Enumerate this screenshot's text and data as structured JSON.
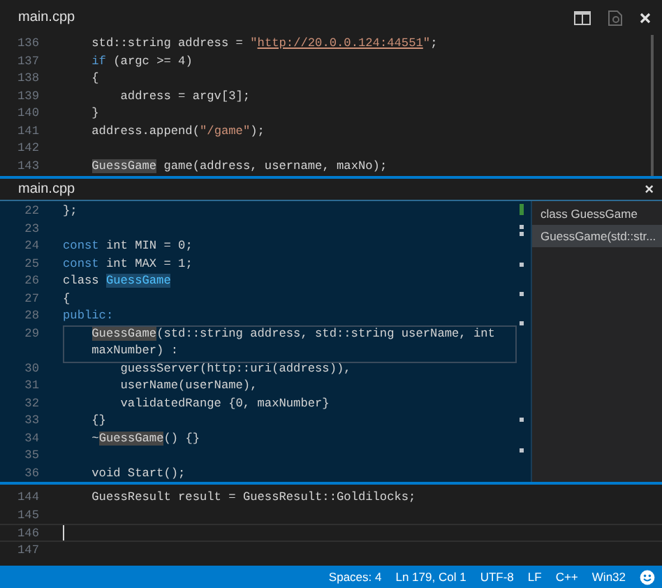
{
  "editor": {
    "tab": {
      "title": "main.cpp"
    },
    "lines": [
      {
        "number": "136",
        "tokens": [
          {
            "text": "    std::string address = ",
            "kind": "plain"
          },
          {
            "text": "\"",
            "kind": "string"
          },
          {
            "text": "http://20.0.0.124:44551",
            "kind": "link"
          },
          {
            "text": "\"",
            "kind": "string"
          },
          {
            "text": ";",
            "kind": "plain"
          }
        ]
      },
      {
        "number": "137",
        "tokens": [
          {
            "text": "    if",
            "kind": "keyword"
          },
          {
            "text": " (argc >= 4)",
            "kind": "plain"
          }
        ]
      },
      {
        "number": "138",
        "tokens": [
          {
            "text": "    {",
            "kind": "plain"
          }
        ]
      },
      {
        "number": "139",
        "tokens": [
          {
            "text": "        address = argv[3];",
            "kind": "plain"
          }
        ]
      },
      {
        "number": "140",
        "tokens": [
          {
            "text": "    }",
            "kind": "plain"
          }
        ]
      },
      {
        "number": "141",
        "tokens": [
          {
            "text": "    address.append(",
            "kind": "plain"
          },
          {
            "text": "\"/game\"",
            "kind": "string"
          },
          {
            "text": ");",
            "kind": "plain"
          }
        ]
      },
      {
        "number": "142"
      },
      {
        "number": "143",
        "tokens": [
          {
            "text": "    GuessGame",
            "kind": "highlight"
          },
          {
            "text": " game(address, username, maxNo);",
            "kind": "plain"
          }
        ]
      }
    ],
    "peek": {
      "title": "main.cpp",
      "close": "×",
      "lines": [
        {
          "number": "22",
          "tokens": [
            {
              "text": "};",
              "kind": "plain"
            }
          ]
        },
        {
          "number": "23"
        },
        {
          "number": "24",
          "tokens": [
            {
              "text": "const",
              "kind": "keyword"
            },
            {
              "text": " int MIN = 0;",
              "kind": "plain"
            }
          ]
        },
        {
          "number": "25",
          "tokens": [
            {
              "text": "const",
              "kind": "keyword"
            },
            {
              "text": " int MAX = 1;",
              "kind": "plain"
            }
          ]
        },
        {
          "number": "26",
          "tokens": [
            {
              "text": "class ",
              "kind": "plain"
            },
            {
              "text": "GuessGame",
              "kind": "definition"
            }
          ]
        },
        {
          "number": "27",
          "tokens": [
            {
              "text": "{",
              "kind": "plain"
            }
          ]
        },
        {
          "number": "28",
          "tokens": [
            {
              "text": "public:",
              "kind": "keyword"
            }
          ]
        },
        {
          "number": "29",
          "current": true,
          "tokens": [
            {
              "text": "    GuessGame",
              "kind": "highlight"
            },
            {
              "text": "(std::string address, std::string userName, int",
              "kind": "plain"
            }
          ],
          "wrapped": [
            {
              "text": "    maxNumber) :",
              "kind": "plain"
            }
          ]
        },
        {
          "number": "30",
          "tokens": [
            {
              "text": "        guessServer(http::uri(address)),",
              "kind": "plain"
            }
          ]
        },
        {
          "number": "31",
          "tokens": [
            {
              "text": "        userName(userName),",
              "kind": "plain"
            }
          ]
        },
        {
          "number": "32",
          "tokens": [
            {
              "text": "        validatedRange {0, maxNumber}",
              "kind": "plain"
            }
          ]
        },
        {
          "number": "33",
          "tokens": [
            {
              "text": "    {}",
              "kind": "plain"
            }
          ]
        },
        {
          "number": "34",
          "tokens": [
            {
              "text": "    ~",
              "kind": "plain"
            },
            {
              "text": "GuessGame",
              "kind": "highlight"
            },
            {
              "text": "() {}",
              "kind": "plain"
            }
          ]
        },
        {
          "number": "35"
        },
        {
          "number": "36",
          "tokens": [
            {
              "text": "    void Start();",
              "kind": "plain"
            }
          ]
        }
      ],
      "references": [
        {
          "label": "class GuessGame",
          "selected": false
        },
        {
          "label": "GuessGame(std::str...",
          "selected": true
        }
      ]
    },
    "lines_after": [
      {
        "number": "144",
        "tokens": [
          {
            "text": "    GuessResult result = GuessResult::Goldilocks;",
            "kind": "plain"
          }
        ]
      },
      {
        "number": "145"
      },
      {
        "number": "146",
        "cursor": true
      },
      {
        "number": "147"
      }
    ]
  },
  "status_bar": {
    "items": [
      "Spaces: 4",
      "Ln 179, Col 1",
      "UTF-8",
      "LF",
      "C++",
      "Win32"
    ]
  }
}
